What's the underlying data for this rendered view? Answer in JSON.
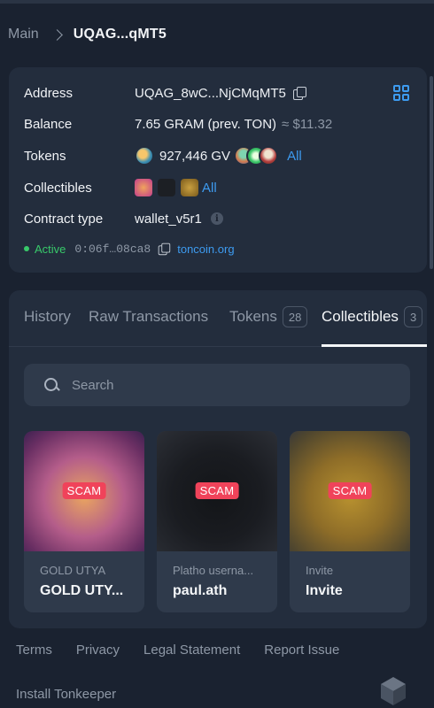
{
  "breadcrumb": {
    "main": "Main",
    "current": "UQAG...qMT5"
  },
  "account": {
    "address_label": "Address",
    "address_value": "UQAG_8wC...NjCMqMT5",
    "balance_label": "Balance",
    "balance_value": "7.65 GRAM (prev. TON)",
    "balance_usd": "≈ $11.32",
    "tokens_label": "Tokens",
    "tokens_value": "927,446 GV",
    "tokens_all": "All",
    "collectibles_label": "Collectibles",
    "collectibles_all": "All",
    "contract_label": "Contract type",
    "contract_value": "wallet_v5r1",
    "status": "Active",
    "hash": "0:06f…08ca8",
    "domain": "toncoin.org"
  },
  "tabs": [
    {
      "label": "History"
    },
    {
      "label": "Raw Transactions"
    },
    {
      "label": "Tokens",
      "count": "28"
    },
    {
      "label": "Collectibles",
      "count": "3"
    }
  ],
  "search": {
    "placeholder": "Search"
  },
  "nfts": [
    {
      "badge": "SCAM",
      "collection": "GOLD UTYA",
      "name": "GOLD UTY..."
    },
    {
      "badge": "SCAM",
      "collection": "Platho userna...",
      "name": "paul.ath"
    },
    {
      "badge": "SCAM",
      "collection": "Invite",
      "name": "Invite"
    }
  ],
  "footer": {
    "links": [
      "Terms",
      "Privacy",
      "Legal Statement",
      "Report Issue"
    ],
    "install": "Install Tonkeeper"
  },
  "colors": {
    "accent": "#3d9bf0",
    "active": "#38c96a",
    "scam": "#f0435a",
    "background": "#1a2230",
    "card": "#232d3d"
  }
}
